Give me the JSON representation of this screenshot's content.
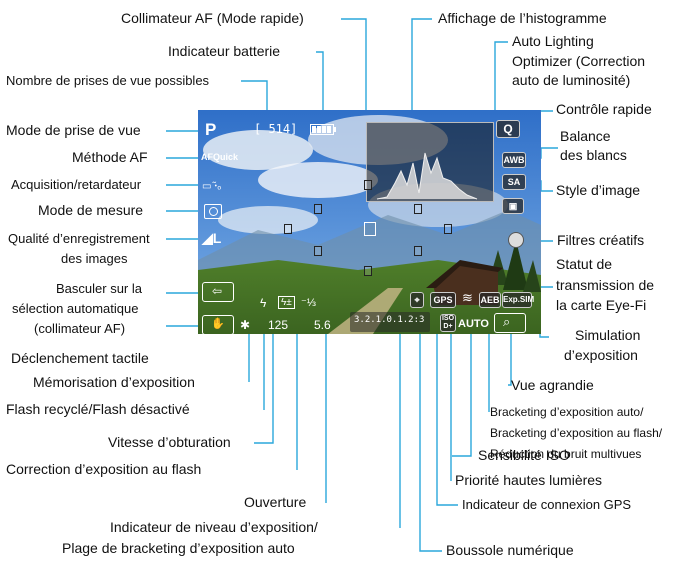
{
  "labels": {
    "collimateur_af": "Collimateur AF (Mode rapide)",
    "affichage_histogramme": "Affichage de l’histogramme",
    "indicateur_batterie": "Indicateur batterie",
    "auto_lighting_1": "Auto Lighting",
    "auto_lighting_2": "Optimizer (Correction",
    "auto_lighting_3": "auto de luminosité)",
    "nombre_prises": "Nombre de prises de vue possibles",
    "controle_rapide": "Contrôle rapide",
    "mode_prise_vue": "Mode de prise de vue",
    "balance_1": "Balance",
    "balance_2": "des blancs",
    "methode_af": "Méthode AF",
    "acquisition": "Acquisition/retardateur",
    "style_image": "Style d’image",
    "mode_mesure": "Mode de mesure",
    "qualite_1": "Qualité d’enregistrement",
    "qualite_2": "des images",
    "filtres_creatifs": "Filtres créatifs",
    "statut_1": "Statut de",
    "statut_2": "transmission de",
    "statut_3": "la carte Eye-Fi",
    "basculer_1": "Basculer sur la",
    "basculer_2": "sélection automatique",
    "basculer_3": "(collimateur AF)",
    "simulation_1": "Simulation",
    "simulation_2": "d’exposition",
    "declenchement_tactile": "Déclenchement tactile",
    "memorisation": "Mémorisation d’exposition",
    "vue_agrandie": "Vue agrandie",
    "flash_recycle": "Flash recyclé/Flash désactivé",
    "bracketing_1": "Bracketing d’exposition auto/",
    "bracketing_2": "Bracketing d’exposition au flash/",
    "bracketing_3": "Réduction du bruit multivues",
    "vitesse": "Vitesse d’obturation",
    "sensibilite_iso": "Sensibilité ISO",
    "correction_flash": "Correction d’exposition au flash",
    "priorite_hautes": "Priorité hautes lumières",
    "ouverture": "Ouverture",
    "connexion_gps": "Indicateur de connexion GPS",
    "niveau_1": "Indicateur de niveau d’exposition/",
    "niveau_2": "Plage de bracketing d’exposition auto",
    "boussole": "Boussole numérique"
  },
  "screen": {
    "mode": "P",
    "shots": "[ 514]",
    "af_method": "AFQuick",
    "drive": "▭ ꞏ̃ₒ",
    "awb": "AWB",
    "q": "Q",
    "style": "SA",
    "flash": "ϟ",
    "flash_comp": "⁻⅓",
    "flash_icon": "±",
    "star": "✱",
    "shutter": "125",
    "aperture": "5.6",
    "scale": "3.2.1.0.1.2:3",
    "gps": "GPS",
    "aeb": "AEB",
    "expsim": "Exp.SIM",
    "iso": "AUTO",
    "iso_small": "ISO",
    "d_plus": "D+",
    "magnify": "⌕",
    "quality": "◢L"
  },
  "colors": {
    "leader_line": "#2aa7dc",
    "sky": "#3e7fd1",
    "grass": "#5b8d2e"
  }
}
